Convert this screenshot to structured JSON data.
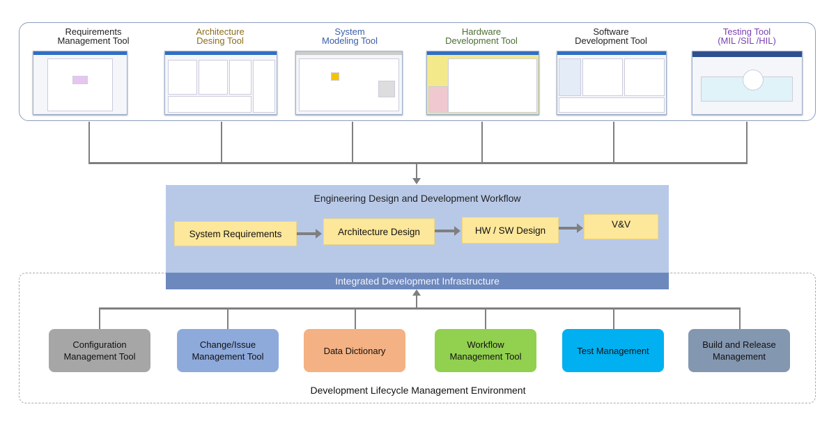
{
  "tools": [
    {
      "line1": "Requirements",
      "line2": "Management Tool",
      "color": "#222222"
    },
    {
      "line1": "Architecture",
      "line2": "Desing Tool",
      "color": "#8a6d1a"
    },
    {
      "line1": "System",
      "line2": "Modeling Tool",
      "color": "#3a5da8"
    },
    {
      "line1": "Hardware",
      "line2": "Development Tool",
      "color": "#4a6e33"
    },
    {
      "line1": "Software",
      "line2": "Development Tool",
      "color": "#222222"
    },
    {
      "line1": "Testing Tool",
      "line2": "(MIL /SIL /HIL)",
      "color": "#7a3fb0"
    }
  ],
  "workflow": {
    "title": "Engineering  Design and Development Workflow",
    "steps": [
      "System Requirements",
      "Architecture Design",
      "HW / SW Design",
      "V&V"
    ],
    "step_color": "#fde79a",
    "background": "#b8c9e8"
  },
  "infrastructure": {
    "label": "Integrated Development Infrastructure",
    "color": "#6d88bd"
  },
  "modules": [
    {
      "line1": "Configuration",
      "line2": "Management Tool",
      "color": "#a6a6a6"
    },
    {
      "line1": "Change/Issue",
      "line2": "Management Tool",
      "color": "#8eaadb"
    },
    {
      "line1": "Data Dictionary",
      "line2": "",
      "color": "#f4b183"
    },
    {
      "line1": "Workflow",
      "line2": "Management Tool",
      "color": "#92d050"
    },
    {
      "line1": "Test Management",
      "line2": "",
      "color": "#00b0f0"
    },
    {
      "line1": "Build and Release",
      "line2": "Management",
      "color": "#8497b0"
    }
  ],
  "environment_label": "Development Lifecycle Management Environment"
}
